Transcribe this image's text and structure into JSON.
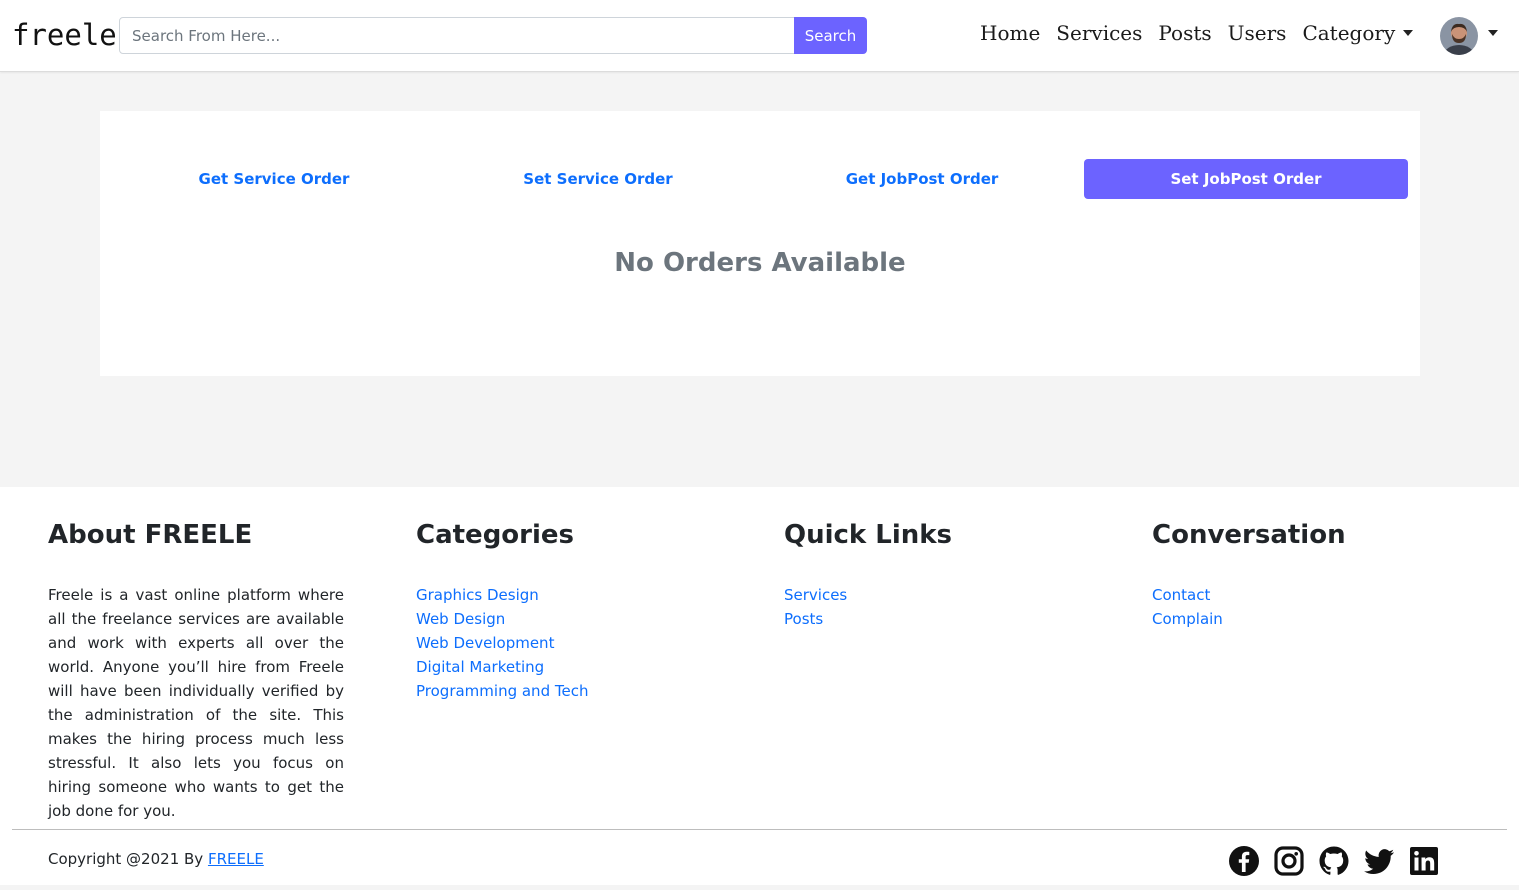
{
  "navbar": {
    "brand": "freele",
    "search_placeholder": "Search From Here...",
    "search_button": "Search",
    "links": [
      "Home",
      "Services",
      "Posts",
      "Users",
      "Category"
    ],
    "accent": "#6c63ff"
  },
  "orders": {
    "tabs": [
      "Get Service Order",
      "Set Service Order",
      "Get JobPost Order",
      "Set JobPost Order"
    ],
    "active_tab": "Set JobPost Order",
    "empty_message": "No Orders Available"
  },
  "footer": {
    "about": {
      "title": "About FREELE",
      "text": "Freele is a vast online platform where all the freelance services are available and work with experts all over the world. Anyone you’ll hire from Freele will have been individually verified by the administration of the site. This makes the hiring process much less stressful. It also lets you focus on hiring someone who wants to get the job done for you."
    },
    "categories": {
      "title": "Categories",
      "items": [
        "Graphics Design",
        "Web Design",
        "Web Development",
        "Digital Marketing",
        "Programming and Tech"
      ]
    },
    "quick_links": {
      "title": "Quick Links",
      "items": [
        "Services",
        "Posts"
      ]
    },
    "conversation": {
      "title": "Conversation",
      "items": [
        "Contact",
        "Complain"
      ]
    },
    "copyright_prefix": "Copyright @2021 By ",
    "copyright_link": "FREELE",
    "socials": [
      "facebook-icon",
      "instagram-icon",
      "github-icon",
      "twitter-icon",
      "linkedin-icon"
    ]
  }
}
